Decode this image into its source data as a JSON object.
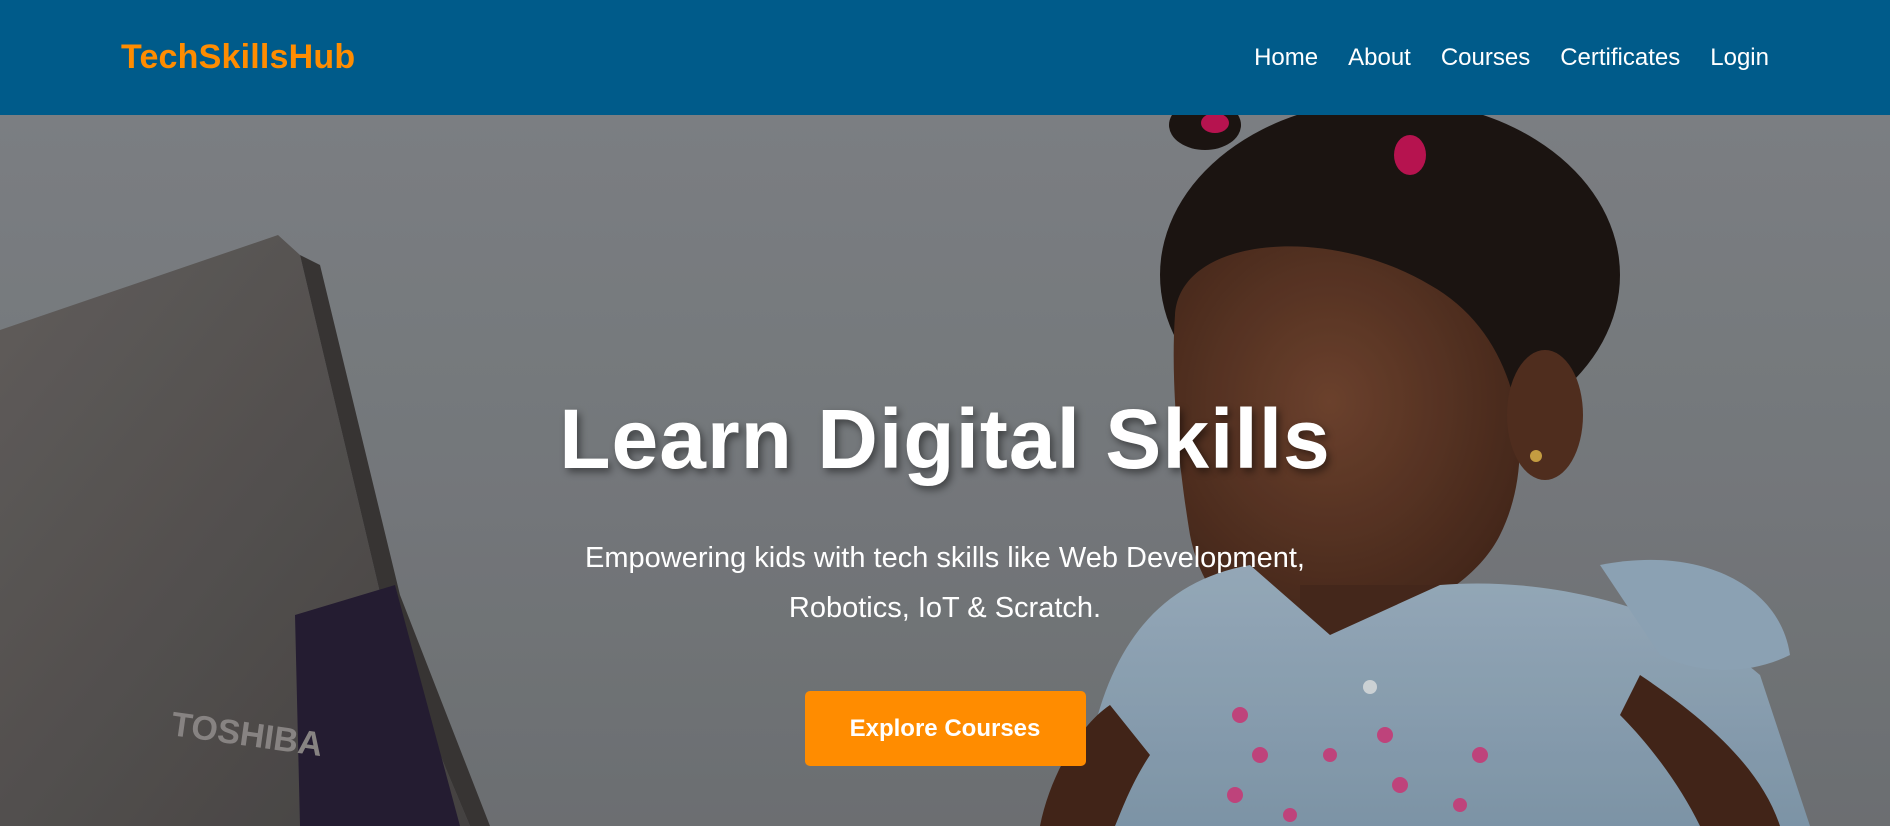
{
  "brand": {
    "logo": "TechSkillsHub"
  },
  "nav": {
    "items": [
      {
        "label": "Home"
      },
      {
        "label": "About"
      },
      {
        "label": "Courses"
      },
      {
        "label": "Certificates"
      },
      {
        "label": "Login"
      }
    ]
  },
  "hero": {
    "title": "Learn Digital Skills",
    "subtitle": "Empowering kids with tech skills like Web Development, Robotics, IoT & Scratch.",
    "cta_label": "Explore Courses",
    "laptop_brand": "TOSHIBA"
  },
  "colors": {
    "navbar": "#005b8a",
    "accent": "#ff8c00",
    "text": "#ffffff"
  }
}
